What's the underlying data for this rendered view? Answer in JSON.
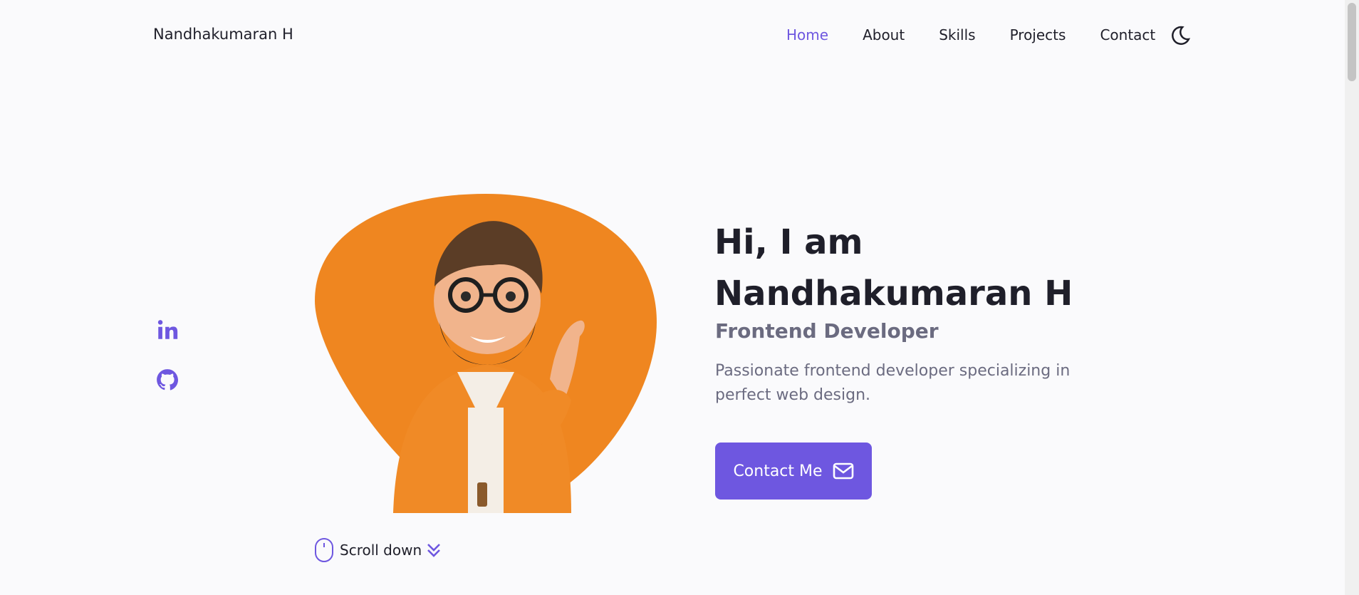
{
  "header": {
    "logo": "Nandhakumaran H",
    "nav": [
      {
        "label": "Home",
        "active": true
      },
      {
        "label": "About",
        "active": false
      },
      {
        "label": "Skills",
        "active": false
      },
      {
        "label": "Projects",
        "active": false
      },
      {
        "label": "Contact",
        "active": false
      }
    ],
    "theme_icon": "moon-icon"
  },
  "social": [
    {
      "name": "linkedin-icon"
    },
    {
      "name": "github-icon"
    }
  ],
  "hero": {
    "title_line1": "Hi, I am",
    "title_line2": "Nandhakumaran H",
    "subtitle": "Frontend Developer",
    "description": "Passionate frontend developer specializing in perfect web design.",
    "button_label": "Contact Me",
    "button_icon": "mail-icon",
    "scroll_label": "Scroll down"
  },
  "colors": {
    "accent": "#6e57e0",
    "blob": "#ef8620",
    "background": "#fafafc"
  }
}
